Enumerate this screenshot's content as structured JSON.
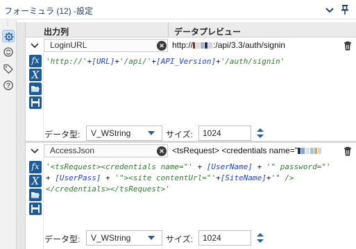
{
  "window": {
    "title": "フォーミュラ (12) -設定"
  },
  "grid": {
    "headers": {
      "output_column": "出力列",
      "data_preview": "データプレビュー"
    },
    "rows": [
      {
        "field_name": "LoginURL",
        "preview_prefix": "http://",
        "preview_suffix": ":/api/3.3/auth/signin",
        "expression_parts": [
          {
            "t": "s",
            "v": "'http://'"
          },
          {
            "t": "o",
            "v": "+"
          },
          {
            "t": "f",
            "v": "[URL]"
          },
          {
            "t": "o",
            "v": "+"
          },
          {
            "t": "s",
            "v": "'/api/'"
          },
          {
            "t": "o",
            "v": "+"
          },
          {
            "t": "f",
            "v": "[API_Version]"
          },
          {
            "t": "o",
            "v": "+"
          },
          {
            "t": "s",
            "v": "'/auth/signin'"
          }
        ],
        "data_type_label": "データ型:",
        "data_type": "V_WString",
        "size_label": "サイズ:",
        "size": "1024"
      },
      {
        "field_name": "AccessJson",
        "preview_prefix": "<tsRequest> <credentials name=\"",
        "preview_suffix": "",
        "expression_parts": [
          {
            "t": "s",
            "v": "'<tsRequest><credentials name=\"'"
          },
          {
            "t": "o",
            "v": " + "
          },
          {
            "t": "f",
            "v": "[UserName]"
          },
          {
            "t": "o",
            "v": " + "
          },
          {
            "t": "s",
            "v": "'\" password=\"'"
          },
          {
            "t": "o",
            "v": "\n+ "
          },
          {
            "t": "f",
            "v": "[UserPass]"
          },
          {
            "t": "o",
            "v": " + "
          },
          {
            "t": "s",
            "v": "'\"><site contentUrl=\"'"
          },
          {
            "t": "o",
            "v": "+"
          },
          {
            "t": "f",
            "v": "[SiteName]"
          },
          {
            "t": "o",
            "v": "+"
          },
          {
            "t": "s",
            "v": "'\" />\n</credentials></tsRequest>'"
          }
        ],
        "data_type_label": "データ型:",
        "data_type": "V_WString",
        "size_label": "サイズ:",
        "size": "1024"
      }
    ]
  },
  "icons": {
    "titlebar": [
      "chevron-down-icon",
      "pin-icon"
    ],
    "leftbar": [
      "settings-gear-icon",
      "refresh-arrows-icon",
      "tag-icon",
      "help-icon"
    ],
    "row_tools": [
      "function-fx-icon",
      "variable-x-icon",
      "open-folder-icon",
      "save-disk-icon"
    ]
  },
  "colors": {
    "accent": "#1c5b97",
    "string_literal": "#2e7d32",
    "field_reference": "#1f46c8",
    "title_text": "#1f3f6b"
  }
}
